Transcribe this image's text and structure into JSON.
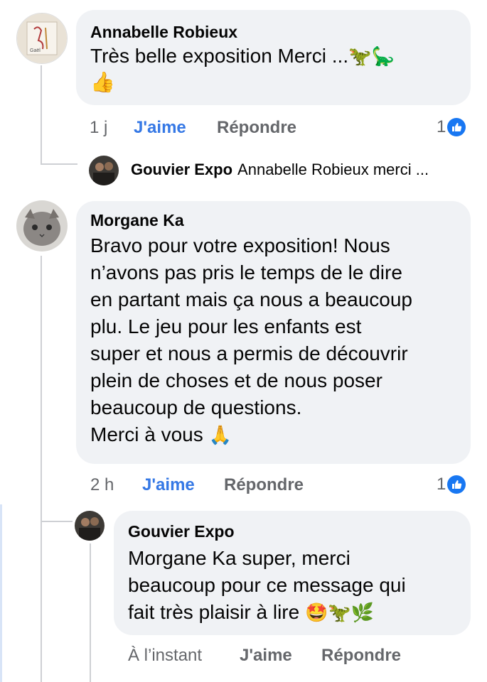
{
  "comments": [
    {
      "author": "Annabelle Robieux",
      "text": "Très belle exposition Merci ...",
      "emoji_inline": "🦖🦕",
      "emoji_line2": "👍",
      "time": "1 j",
      "like_label": "J'aime",
      "reply_label": "Répondre",
      "reaction_count": "1",
      "collapsed_reply": {
        "author": "Gouvier Expo",
        "preview": "Annabelle Robieux merci ..."
      }
    },
    {
      "author": "Morgane Ka",
      "text": "Bravo pour votre exposition!  Nous\nn’avons pas pris le temps de le dire\nen partant mais ça nous a beaucoup\nplu. Le jeu pour les enfants est\nsuper et nous a permis de découvrir\nplein de choses et de nous poser\nbeaucoup de questions.\nMerci à vous",
      "emoji_end": "🙏",
      "time": "2 h",
      "like_label": "J'aime",
      "reply_label": "Répondre",
      "reaction_count": "1",
      "reply": {
        "author": "Gouvier Expo",
        "text": "Morgane Ka super, merci\nbeaucoup pour ce message qui\nfait très plaisir à lire",
        "emoji_end": "🤩🦖🌿",
        "time": "À l’instant",
        "like_label": "J'aime",
        "reply_label": "Répondre"
      }
    }
  ],
  "colors": {
    "bubble": "#f0f2f5",
    "meta_text": "#65676b",
    "like_active": "#3578e5",
    "reaction_blue": "#1877f2",
    "thread_line": "#ced0d4"
  }
}
